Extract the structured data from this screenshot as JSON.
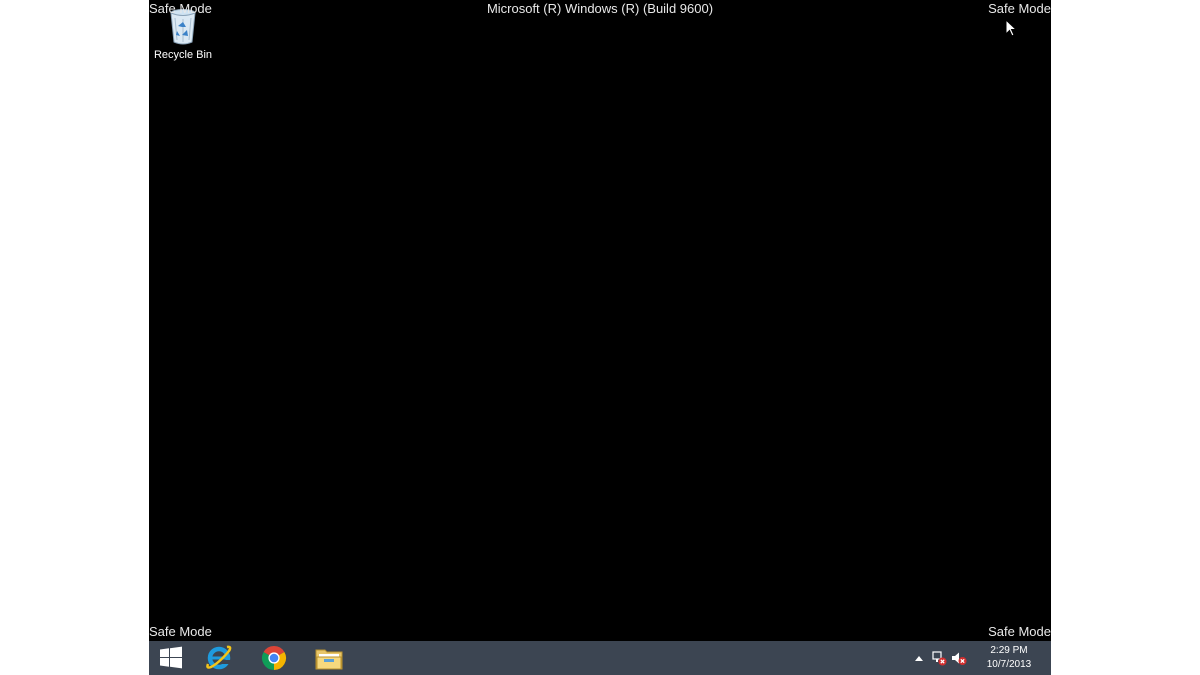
{
  "overlay": {
    "safe_mode_top_left": "Safe Mode",
    "safe_mode_top_right": "Safe Mode",
    "safe_mode_bottom_left": "Safe Mode",
    "safe_mode_bottom_right": "Safe Mode",
    "build_text": "Microsoft (R) Windows (R) (Build 9600)"
  },
  "desktop": {
    "background_color": "#000000",
    "icons": [
      {
        "label": "Recycle Bin",
        "icon": "recycle-bin-icon"
      }
    ]
  },
  "taskbar": {
    "background_color": "#3c4552",
    "buttons": [
      {
        "name": "start-button",
        "icon": "windows-logo-icon"
      },
      {
        "name": "internet-explorer-button",
        "icon": "internet-explorer-icon"
      },
      {
        "name": "chrome-button",
        "icon": "chrome-icon"
      },
      {
        "name": "file-explorer-button",
        "icon": "file-explorer-icon"
      }
    ],
    "tray": {
      "icons": [
        "show-hidden-icons-icon",
        "network-error-icon",
        "volume-muted-icon"
      ],
      "time": "2:29 PM",
      "date": "10/7/2013"
    }
  }
}
